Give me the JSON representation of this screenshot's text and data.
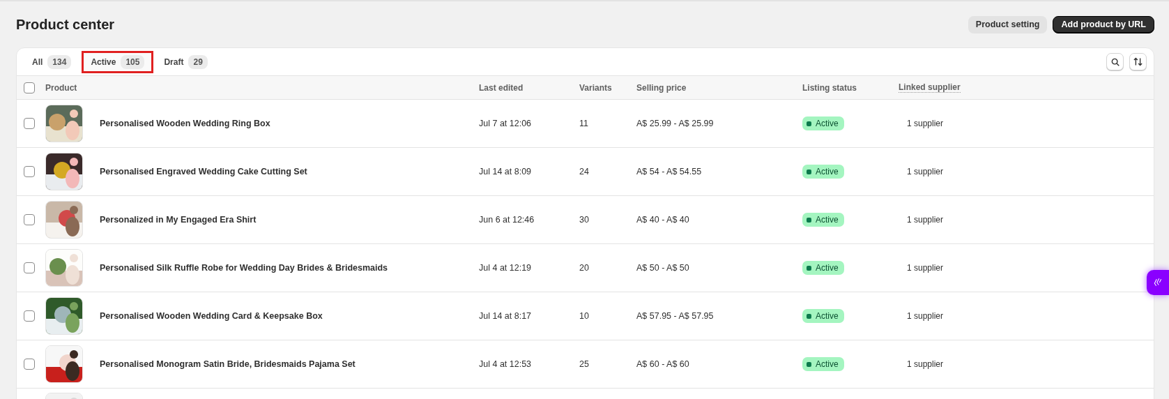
{
  "page_title": "Product center",
  "header_buttons": [
    {
      "label": "Product setting",
      "kind": "secondary"
    },
    {
      "label": "Add product by URL",
      "kind": "primary"
    }
  ],
  "tabs": [
    {
      "label": "All",
      "count": "134",
      "selected": false
    },
    {
      "label": "Active",
      "count": "105",
      "selected": true
    },
    {
      "label": "Draft",
      "count": "29",
      "selected": false
    }
  ],
  "table": {
    "columns": [
      "Product",
      "Last edited",
      "Variants",
      "Selling price",
      "Listing status",
      "Linked supplier"
    ],
    "rows": [
      {
        "product": "Personalised Wooden Wedding Ring Box",
        "last_edited": "Jul 7 at 12:06",
        "variants": "11",
        "price": "A$ 25.99 - A$ 25.99",
        "status": "Active",
        "supplier": "1 supplier",
        "checked": false
      },
      {
        "product": "Personalised Engraved Wedding Cake Cutting Set",
        "last_edited": "Jul 14 at 8:09",
        "variants": "24",
        "price": "A$ 54 - A$ 54.55",
        "status": "Active",
        "supplier": "1 supplier",
        "checked": false
      },
      {
        "product": "Personalized in My Engaged Era Shirt",
        "last_edited": "Jun 6 at 12:46",
        "variants": "30",
        "price": "A$ 40 - A$ 40",
        "status": "Active",
        "supplier": "1 supplier",
        "checked": false
      },
      {
        "product": "Personalised Silk Ruffle Robe for Wedding Day Brides & Bridesmaids",
        "last_edited": "Jul 4 at 12:19",
        "variants": "20",
        "price": "A$ 50 - A$ 50",
        "status": "Active",
        "supplier": "1 supplier",
        "checked": false
      },
      {
        "product": "Personalised Wooden Wedding Card & Keepsake Box",
        "last_edited": "Jul 14 at 8:17",
        "variants": "10",
        "price": "A$ 57.95 - A$ 57.95",
        "status": "Active",
        "supplier": "1 supplier",
        "checked": false
      },
      {
        "product": "Personalised Monogram Satin Bride, Bridesmaids Pajama Set",
        "last_edited": "Jul 4 at 12:53",
        "variants": "25",
        "price": "A$ 60 - A$ 60",
        "status": "Active",
        "supplier": "1 supplier",
        "checked": false
      }
    ],
    "header_checked": false
  }
}
